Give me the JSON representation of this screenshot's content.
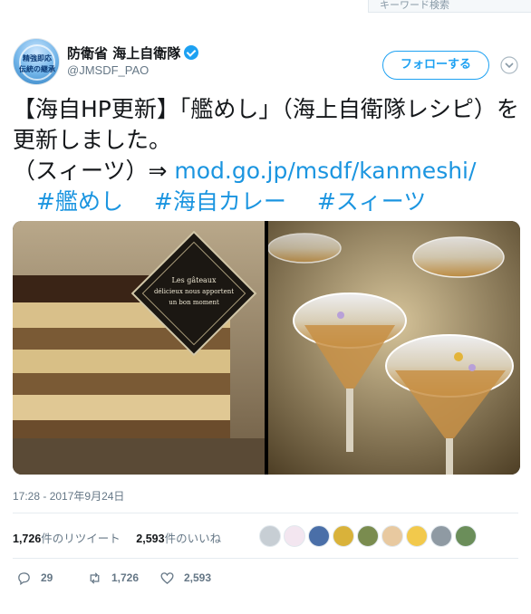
{
  "search": {
    "placeholder": "キーワード検索"
  },
  "account": {
    "name": "防衛省 海上自衛隊",
    "handle": "@JMSDF_PAO",
    "avatar_text_line1": "精強即応",
    "avatar_text_line2": "伝統の継承"
  },
  "follow_button": {
    "label": "フォローする"
  },
  "tweet": {
    "line1": "【海自HP更新】「艦めし」（海上自衛隊レシピ）を更新しました。",
    "line2_prefix": "（スィーツ）⇒ ",
    "link": "mod.go.jp/msdf/kanmeshi/",
    "hashtags": [
      "#艦めし",
      "#海自カレー",
      "#スィーツ"
    ]
  },
  "media": {
    "image1_caption_line1": "Les gâteaux",
    "image1_caption_line2": "délicieux nous apportent",
    "image1_caption_line3": "un bon moment"
  },
  "timestamp": "17:28 - 2017年9月24日",
  "stats": {
    "retweets_count": "1,726",
    "retweets_label": "件のリツイート",
    "likes_count": "2,593",
    "likes_label": "件のいいね"
  },
  "likers": [
    {
      "name": "liker-1",
      "color": "#c7ced4"
    },
    {
      "name": "liker-2",
      "color": "#f3e6f0"
    },
    {
      "name": "liker-3",
      "color": "#4a6fa8"
    },
    {
      "name": "liker-4",
      "color": "#d9b23a"
    },
    {
      "name": "liker-5",
      "color": "#7a8c4f"
    },
    {
      "name": "liker-6",
      "color": "#e8c9a0"
    },
    {
      "name": "liker-7",
      "color": "#f2c94c"
    },
    {
      "name": "liker-8",
      "color": "#8f9aa3"
    },
    {
      "name": "liker-9",
      "color": "#6b8e5a"
    }
  ],
  "actions": {
    "reply_count": "29",
    "retweet_count": "1,726",
    "like_count": "2,593"
  },
  "colors": {
    "accent": "#1da1f2",
    "link": "#1b95e0",
    "muted": "#657786"
  }
}
